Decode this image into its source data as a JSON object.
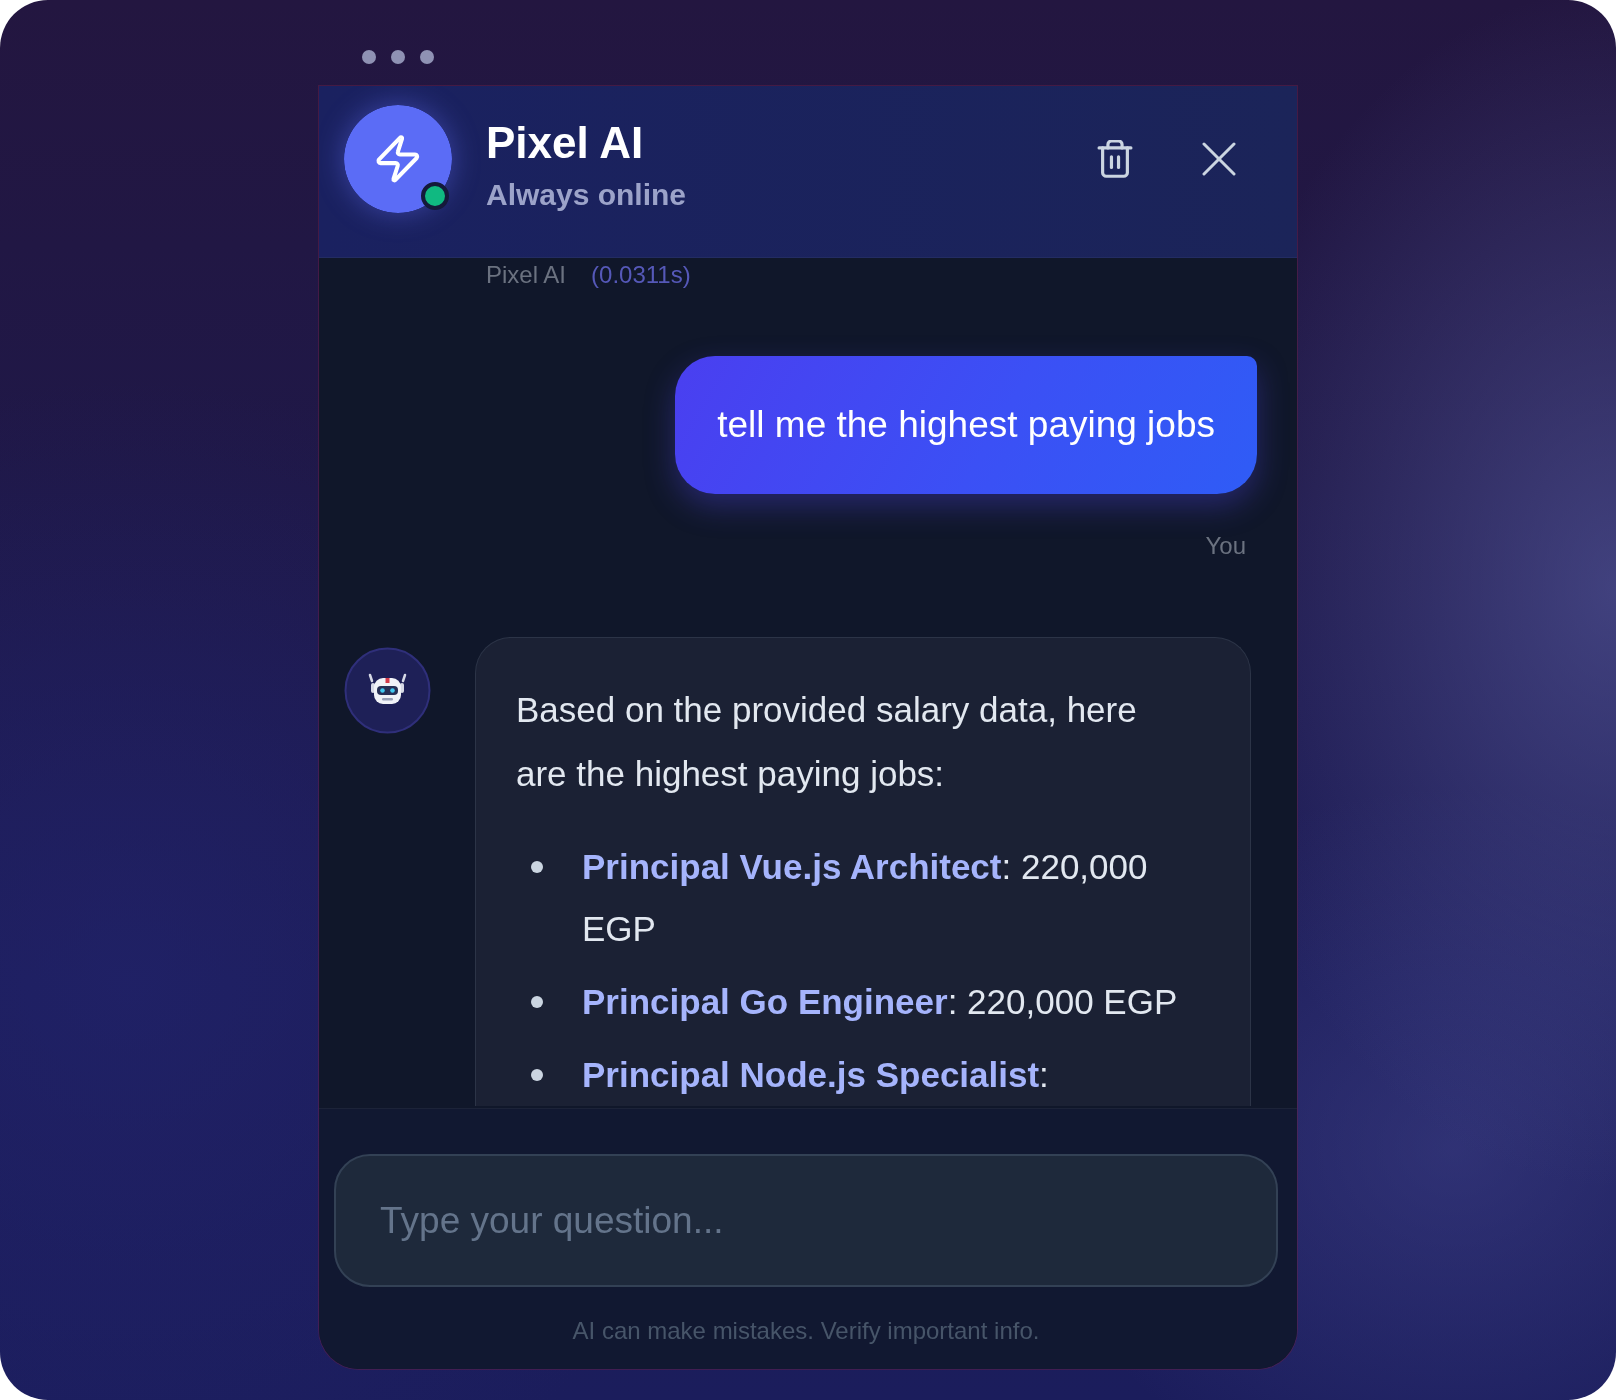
{
  "header": {
    "title": "Pixel AI",
    "status": "Always online",
    "online": true
  },
  "messages": [
    {
      "kind": "caption",
      "sender": "Pixel AI",
      "time": "(0.0311s)"
    },
    {
      "kind": "user",
      "text": "tell me the highest paying jobs",
      "sender": "You"
    },
    {
      "kind": "bot",
      "paragraph": "Based on the provided salary data, here are the highest paying jobs:",
      "items": [
        "**Principal Vue.js Architect**: 220,000 EGP",
        "**Principal Go Engineer**: 220,000 EGP",
        "**Principal Node.js Specialist**:"
      ]
    }
  ],
  "input": {
    "placeholder": "Type your question..."
  },
  "footer": "AI can make mistakes. Verify important info."
}
